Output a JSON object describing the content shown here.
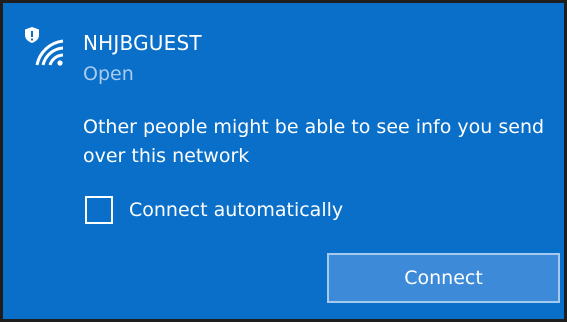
{
  "network": {
    "icon": "wifi-secured-warning-icon",
    "name": "NHJBGUEST",
    "status": "Open"
  },
  "warning_text": "Other people might be able to see info you send over this network",
  "connect_automatically": {
    "label": "Connect automatically",
    "checked": false
  },
  "connect_button": {
    "label": "Connect"
  },
  "colors": {
    "panel_background": "#0a6fc9",
    "button_background": "#3c8ad8",
    "button_border": "#a6c9ee",
    "secondary_text": "#a9cbed"
  }
}
